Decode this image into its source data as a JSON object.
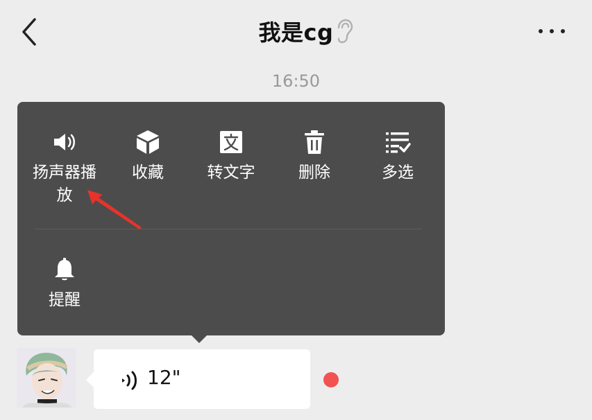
{
  "header": {
    "back_icon": "chevron-left-icon",
    "title": "我是cg",
    "ear_icon": "ear-icon",
    "more_icon": "more-dots-icon"
  },
  "chat": {
    "timestamp": "16:50",
    "context_menu": {
      "items": [
        {
          "label": "扬声器播\n放",
          "icon": "speaker-icon"
        },
        {
          "label": "收藏",
          "icon": "cube-icon"
        },
        {
          "label": "转文字",
          "icon": "text-convert-icon"
        },
        {
          "label": "删除",
          "icon": "trash-icon"
        },
        {
          "label": "多选",
          "icon": "multi-select-icon"
        },
        {
          "label": "提醒",
          "icon": "bell-icon"
        }
      ]
    },
    "message": {
      "type": "voice",
      "duration": "12\"",
      "unread": true,
      "unread_color": "#f25252"
    }
  },
  "colors": {
    "background": "#ededed",
    "menu_background": "#4c4c4c",
    "annotation_arrow": "#e8332a"
  }
}
